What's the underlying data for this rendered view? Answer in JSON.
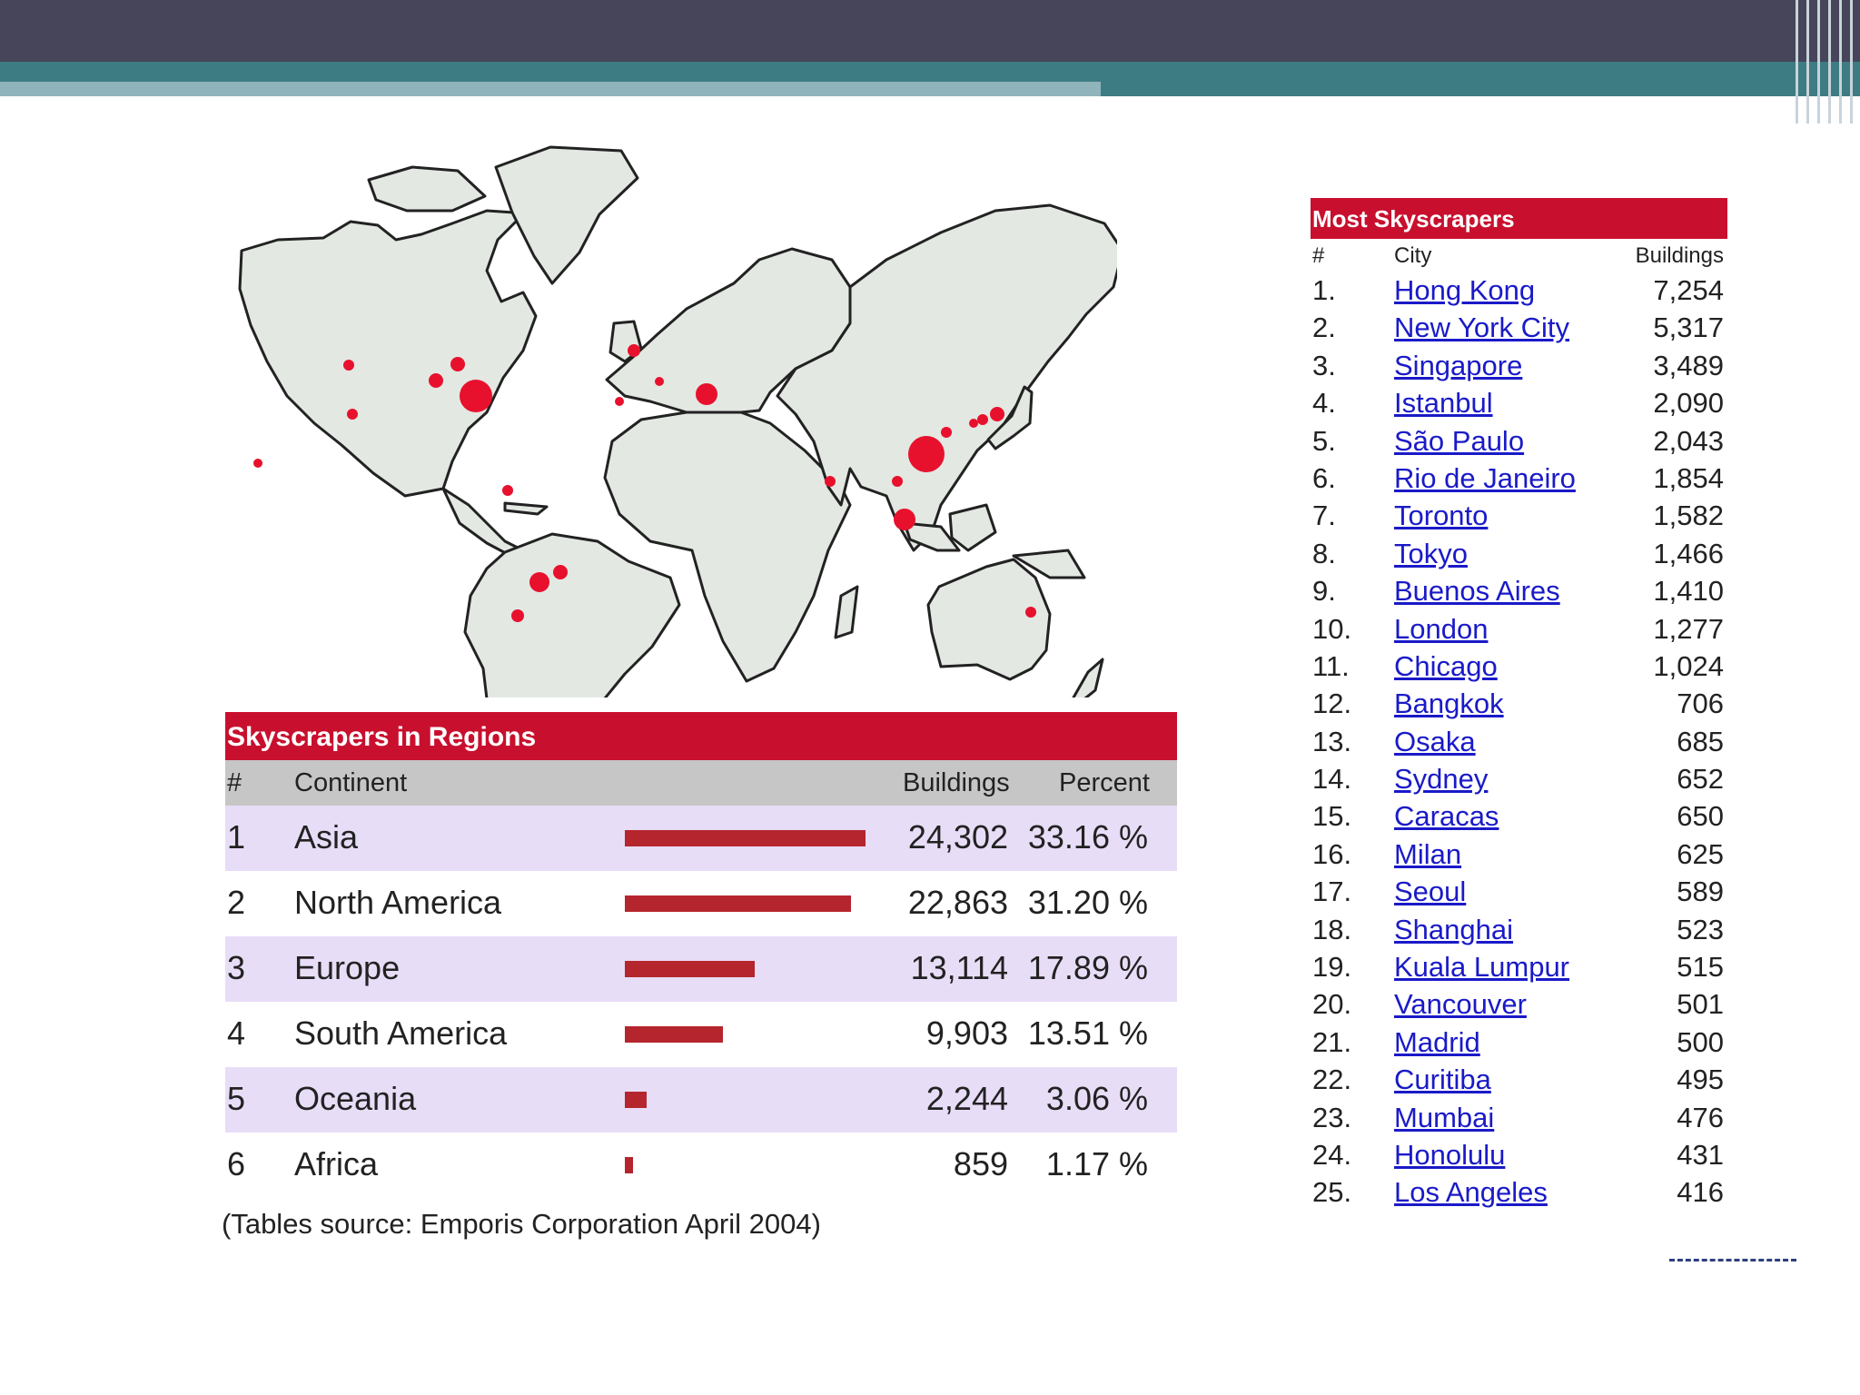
{
  "chart_data": [
    {
      "type": "table",
      "title": "Skyscrapers in Regions",
      "columns": [
        "#",
        "Continent",
        "Buildings",
        "Percent"
      ],
      "rows": [
        {
          "rank": "1",
          "continent": "Asia",
          "buildings": "24,302",
          "percent": "33.16 %",
          "value": 24302
        },
        {
          "rank": "2",
          "continent": "North America",
          "buildings": "22,863",
          "percent": "31.20 %",
          "value": 22863
        },
        {
          "rank": "3",
          "continent": "Europe",
          "buildings": "13,114",
          "percent": "17.89 %",
          "value": 13114
        },
        {
          "rank": "4",
          "continent": "South America",
          "buildings": "9,903",
          "percent": "13.51 %",
          "value": 9903
        },
        {
          "rank": "5",
          "continent": "Oceania",
          "buildings": "2,244",
          "percent": "3.06 %",
          "value": 2244
        },
        {
          "rank": "6",
          "continent": "Africa",
          "buildings": "859",
          "percent": "1.17 %",
          "value": 859
        }
      ],
      "bar_color": "#b5252d",
      "row_highlight": "#e8ddf7"
    },
    {
      "type": "table",
      "title": "Most Skyscrapers",
      "columns": [
        "#",
        "City",
        "Buildings"
      ],
      "rows": [
        {
          "rank": "1.",
          "city": "Hong Kong",
          "buildings": "7,254"
        },
        {
          "rank": "2.",
          "city": "New York City",
          "buildings": "5,317"
        },
        {
          "rank": "3.",
          "city": "Singapore",
          "buildings": "3,489"
        },
        {
          "rank": "4.",
          "city": "Istanbul",
          "buildings": "2,090"
        },
        {
          "rank": "5.",
          "city": "São Paulo",
          "buildings": "2,043"
        },
        {
          "rank": "6.",
          "city": "Rio de Janeiro",
          "buildings": "1,854"
        },
        {
          "rank": "7.",
          "city": "Toronto",
          "buildings": "1,582"
        },
        {
          "rank": "8.",
          "city": "Tokyo",
          "buildings": "1,466"
        },
        {
          "rank": "9.",
          "city": "Buenos Aires",
          "buildings": "1,410"
        },
        {
          "rank": "10.",
          "city": "London",
          "buildings": "1,277"
        },
        {
          "rank": "11.",
          "city": "Chicago",
          "buildings": "1,024"
        },
        {
          "rank": "12.",
          "city": "Bangkok",
          "buildings": "706"
        },
        {
          "rank": "13.",
          "city": "Osaka",
          "buildings": "685"
        },
        {
          "rank": "14.",
          "city": "Sydney",
          "buildings": "652"
        },
        {
          "rank": "15.",
          "city": "Caracas",
          "buildings": "650"
        },
        {
          "rank": "16.",
          "city": "Milan",
          "buildings": "625"
        },
        {
          "rank": "17.",
          "city": "Seoul",
          "buildings": "589"
        },
        {
          "rank": "18.",
          "city": "Shanghai",
          "buildings": "523"
        },
        {
          "rank": "19.",
          "city": "Kuala Lumpur",
          "buildings": "515"
        },
        {
          "rank": "20.",
          "city": "Vancouver",
          "buildings": "501"
        },
        {
          "rank": "21.",
          "city": "Madrid",
          "buildings": "500"
        },
        {
          "rank": "22.",
          "city": "Curitiba",
          "buildings": "495"
        },
        {
          "rank": "23.",
          "city": "Mumbai",
          "buildings": "476"
        },
        {
          "rank": "24.",
          "city": "Honolulu",
          "buildings": "431"
        },
        {
          "rank": "25.",
          "city": "Los Angeles",
          "buildings": "416"
        }
      ],
      "link_color": "#1a1ac8"
    }
  ],
  "source_note": "(Tables source: Emporis Corporation April 2004)",
  "colors": {
    "header_dark": "#464559",
    "header_teal": "#3e7c83",
    "title_red": "#c8102e",
    "map_land": "#e3e8e3",
    "map_dot": "#e8112d"
  }
}
